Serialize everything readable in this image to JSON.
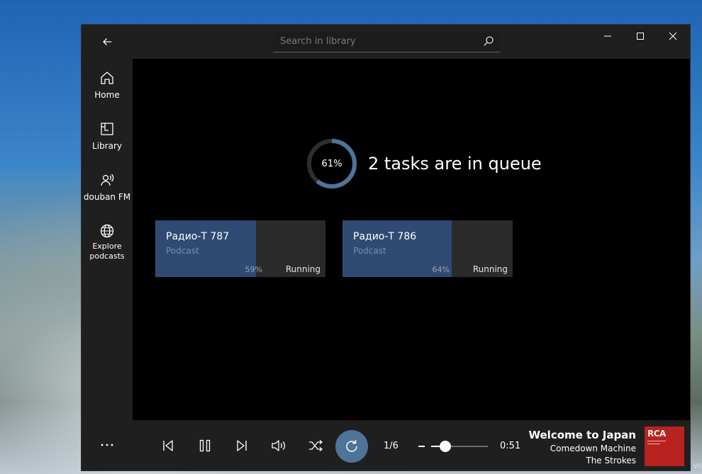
{
  "sidebar": {
    "back_icon": "back-arrow-icon",
    "items": [
      {
        "label": "Home",
        "icon": "home-icon"
      },
      {
        "label": "Library",
        "icon": "library-icon"
      },
      {
        "label": "douban FM",
        "icon": "radio-person-icon"
      },
      {
        "label": "Explore\npodcasts",
        "icon": "globe-icon"
      }
    ],
    "more_icon": "more-dots-icon"
  },
  "titlebar": {
    "search_placeholder": "Search in library",
    "search_icon": "search-icon"
  },
  "queue": {
    "overall_percent_label": "61%",
    "overall_progress": 0.61,
    "title": "2 tasks are in queue",
    "tasks": [
      {
        "name": "Радио-Т 787",
        "type": "Podcast",
        "percent_label": "59%",
        "progress": 0.59,
        "state": "Running"
      },
      {
        "name": "Радио-Т 786",
        "type": "Podcast",
        "percent_label": "64%",
        "progress": 0.64,
        "state": "Running"
      }
    ]
  },
  "player": {
    "track_count": "1/6",
    "time": "0:51",
    "volume_level": 0.25,
    "now_playing": {
      "title": "Welcome to Japan",
      "album": "Comedown Machine",
      "artist": "The Strokes",
      "cover_logo": "RCA"
    }
  },
  "colors": {
    "accent": "#4f7399",
    "progress_fill": "#2f4a73",
    "sidebar_bg": "#1f1f1f",
    "content_bg": "#000000"
  }
}
